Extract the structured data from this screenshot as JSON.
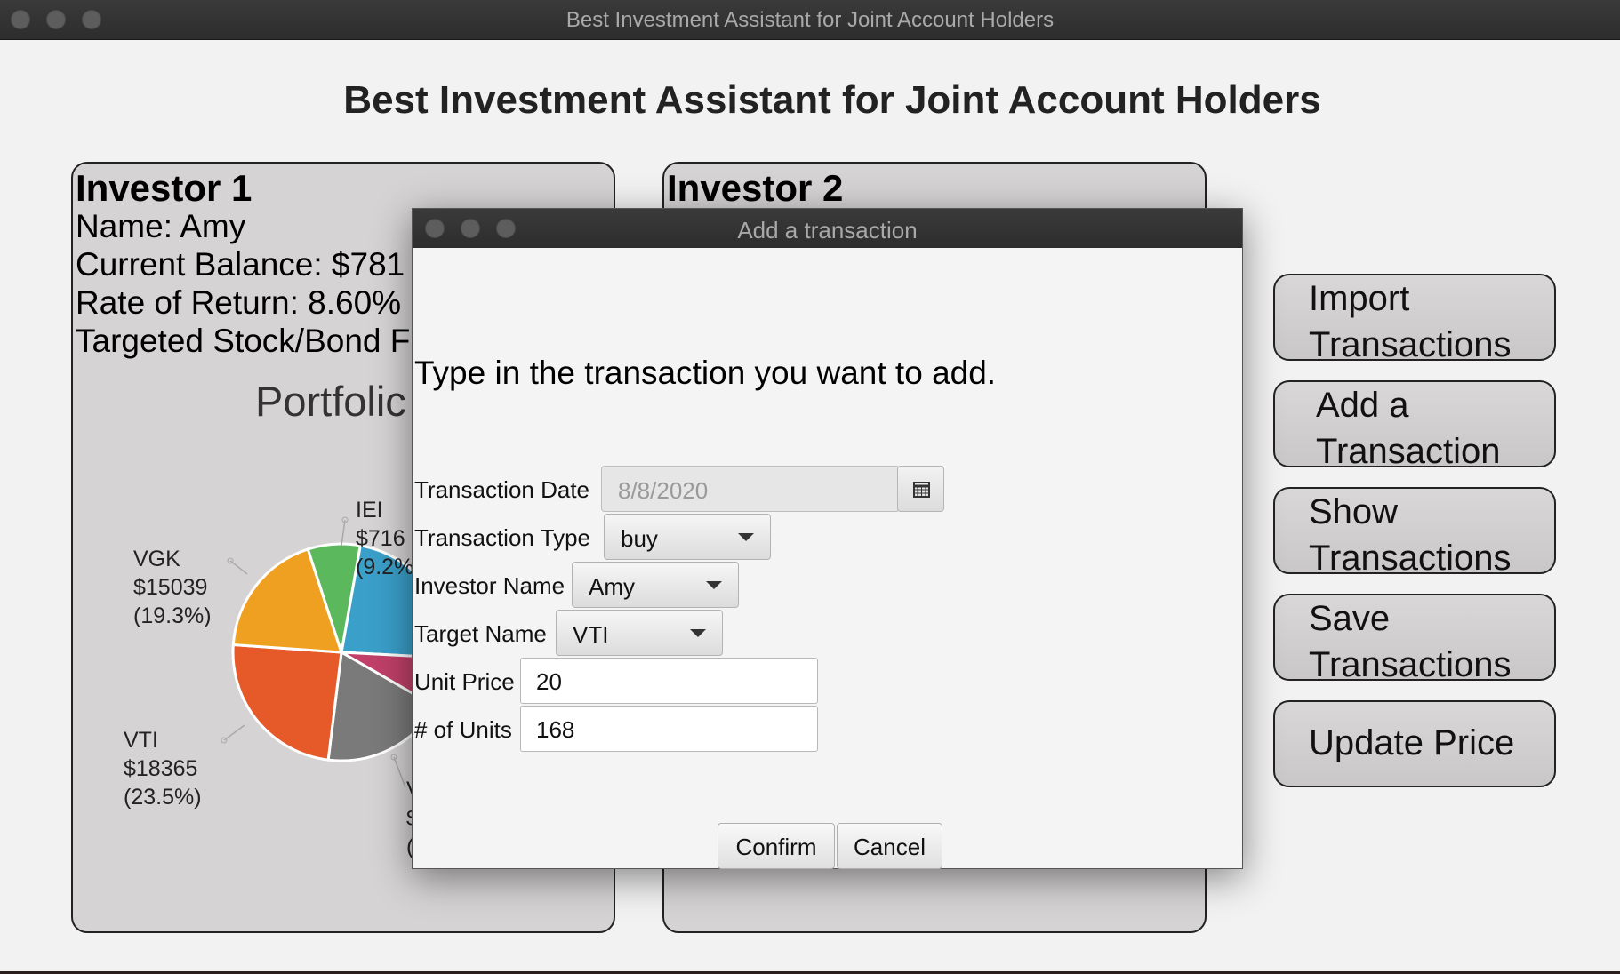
{
  "window": {
    "title": "Best Investment Assistant for Joint Account Holders"
  },
  "app": {
    "heading": "Best Investment Assistant for Joint Account Holders"
  },
  "investor1": {
    "title": "Investor 1",
    "name": "Name: Amy",
    "balance": "Current Balance: $781",
    "return": "Rate of Return: 8.60%",
    "ratio": "Targeted Stock/Bond F",
    "chart_title": "Portfolic"
  },
  "investor2": {
    "title": "Investor 2"
  },
  "chart_data": {
    "type": "pie",
    "title": "Portfolic",
    "slices": [
      {
        "label": "IEI",
        "value_text": "$716",
        "percent_text": "(9.2%",
        "percent": 9.2,
        "color": "#5cb85c"
      },
      {
        "label": "VGK",
        "value_text": "$15039",
        "percent_text": "(19.3%)",
        "value": 15039,
        "percent": 19.3,
        "color": "#f0a020"
      },
      {
        "label": "VTI",
        "value_text": "$18365",
        "percent_text": "(23.5%)",
        "value": 18365,
        "percent": 23.5,
        "color": "#e65a2a"
      },
      {
        "label": "V",
        "value_text": "$",
        "percent_text": "(",
        "color": "#7a7a7a"
      },
      {
        "label": "",
        "color": "#c0406a"
      },
      {
        "label": "",
        "color": "#3a9fc9"
      }
    ]
  },
  "sidebar": {
    "import": [
      "Import",
      "Transactions"
    ],
    "add": [
      "Add a",
      "Transaction"
    ],
    "show": [
      "Show",
      "Transactions"
    ],
    "save": [
      "Save",
      "Transactions"
    ],
    "update": "Update Price"
  },
  "dialog": {
    "title": "Add a transaction",
    "prompt": "Type in the transaction you want to add.",
    "date_label": "Transaction Date",
    "date_value": "8/8/2020",
    "type_label": "Transaction Type",
    "type_value": "buy",
    "investor_label": "Investor Name",
    "investor_value": "Amy",
    "target_label": "Target Name",
    "target_value": "VTI",
    "price_label": "Unit Price",
    "price_value": "20",
    "units_label": "# of Units",
    "units_value": "168",
    "confirm": "Confirm",
    "cancel": "Cancel"
  }
}
